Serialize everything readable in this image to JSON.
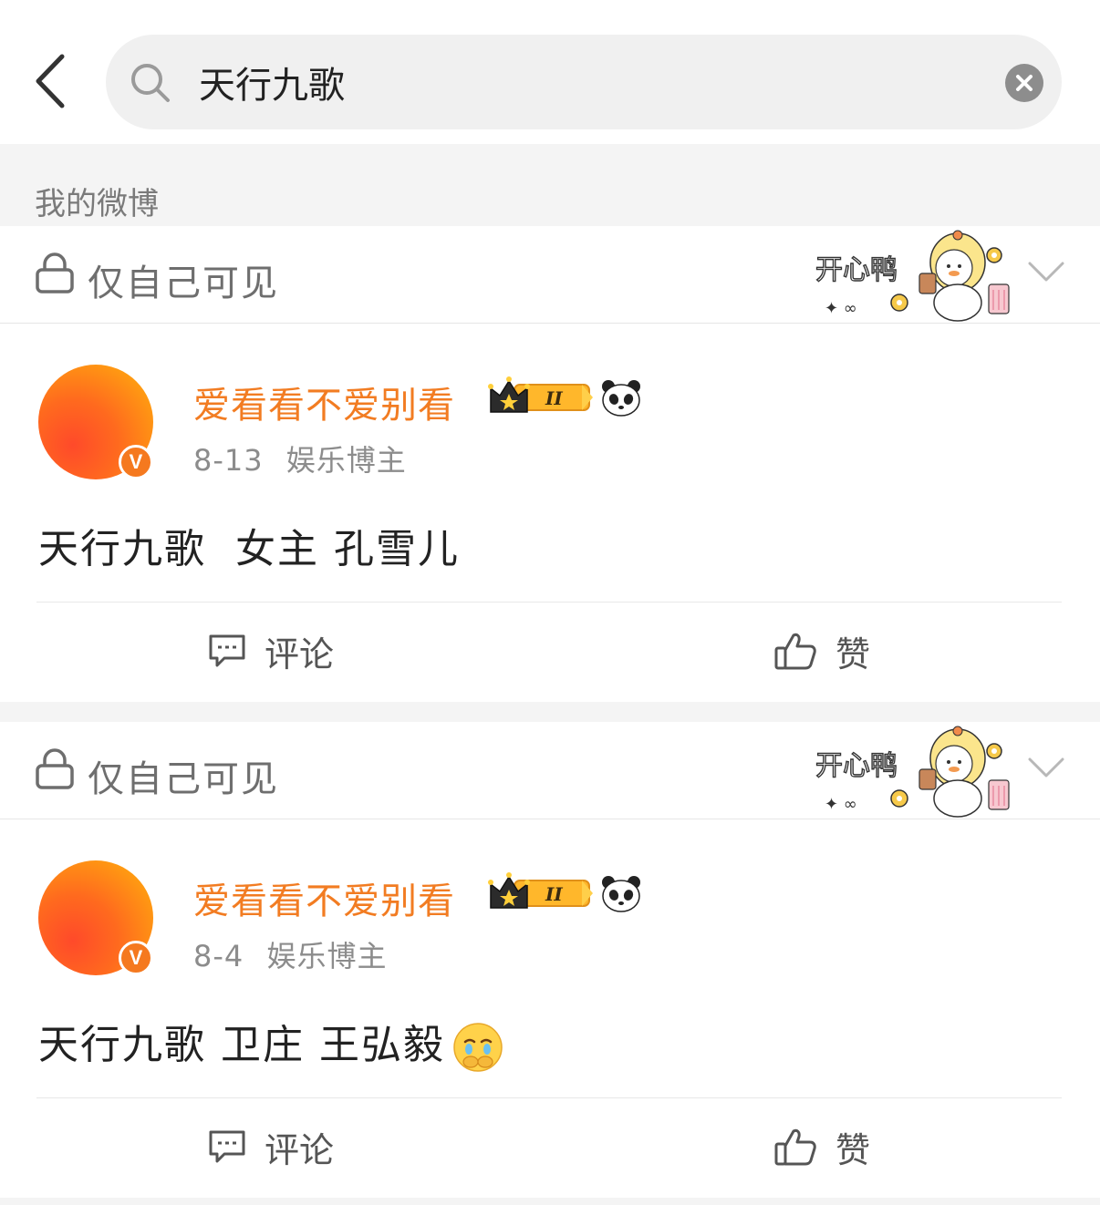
{
  "header": {
    "search_value": "天行九歌",
    "section_label": "我的微博"
  },
  "icons": {
    "back": "chevron-left-icon",
    "search": "magnifier-icon",
    "clear": "x-circle-icon",
    "lock": "lock-icon",
    "expand": "chevron-down-icon",
    "comment": "comment-bubble-icon",
    "like": "thumbs-up-icon"
  },
  "colors": {
    "username": "#f27c22",
    "badge": "#f5791f",
    "page_bg": "#f4f4f4"
  },
  "posts": [
    {
      "visibility": "仅自己可见",
      "sticker_text": "开心鸭",
      "author": "爱看看不爱别看",
      "badge_level": "II",
      "date": "8-13",
      "tag": "娱乐博主",
      "content": "天行九歌  女主 孔雪儿",
      "comment_label": "评论",
      "like_label": "赞"
    },
    {
      "visibility": "仅自己可见",
      "sticker_text": "开心鸭",
      "author": "爱看看不爱别看",
      "badge_level": "II",
      "date": "8-4",
      "tag": "娱乐博主",
      "content": "天行九歌 卫庄 王弘毅",
      "comment_label": "评论",
      "like_label": "赞"
    }
  ]
}
